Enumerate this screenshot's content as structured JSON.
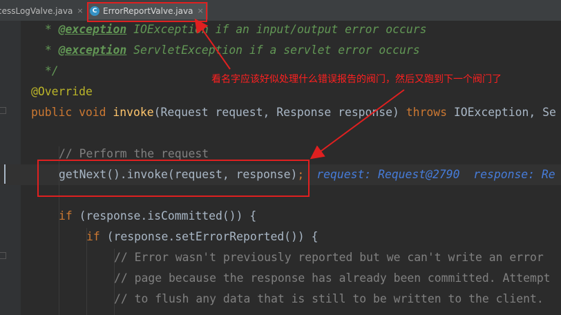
{
  "tabs": [
    {
      "label": "cessLogValve.java",
      "close": "×",
      "active": false
    },
    {
      "label": "ErrorReportValve.java",
      "close": "×",
      "active": true,
      "icon": "C"
    }
  ],
  "code": {
    "l1": {
      "star": " * ",
      "tag": "@exception",
      "type": " IOException",
      "desc": " if an input/output error occurs"
    },
    "l2": {
      "star": " * ",
      "tag": "@exception",
      "type": " ServletException",
      "desc": " if a servlet error occurs"
    },
    "l3": " */",
    "l4": "@Override",
    "l5": {
      "kw1": "public void ",
      "name": "invoke",
      "params": "(Request request, Response response) ",
      "kw2": "throws",
      "rest": " IOException, Se"
    },
    "l6": "",
    "l7": "// Perform the request",
    "l8": {
      "call": "getNext().invoke(request, response)",
      "semi": ";",
      "debug": "request: Request@2790  response: Re"
    },
    "l9": "",
    "l10": {
      "kw": "if",
      "rest": " (response.isCommitted()) {"
    },
    "l11": {
      "kw": "if",
      "rest": " (response.setErrorReported()) {"
    },
    "l12": "// Error wasn't previously reported but we can't write an error",
    "l13": "// page because the response has already been committed. Attempt",
    "l14": "// to flush any data that is still to be written to the client."
  },
  "annotation": "看名字应该好似处理什么错误报告的阀门，然后又跑到下一个阀门了",
  "colors": {
    "highlight": "#e02020",
    "keyword": "#cc7832",
    "method": "#ffc66d",
    "comment": "#808080",
    "javadoc": "#629755"
  }
}
